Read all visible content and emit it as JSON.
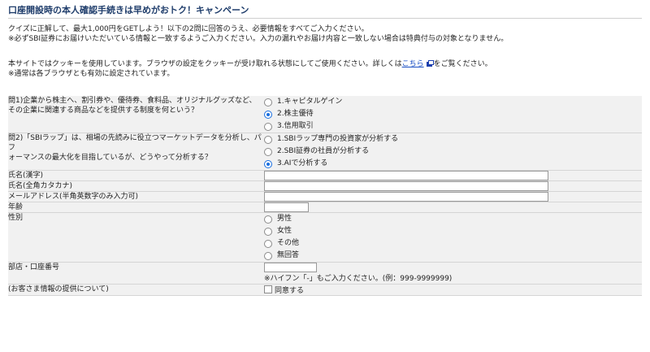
{
  "page": {
    "title": "口座開設時の本人確認手続きは早めがおトク！キャンペーン",
    "intro_line1": "クイズに正解して、最大1,000円をGETしよう！以下の2問に回答のうえ、必要情報をすべてご入力ください。",
    "intro_line2": "※必ずSBI証券にお届けいただいている情報と一致するようご入力ください。入力の漏れやお届け内容と一致しない場合は特典付与の対象となりません。",
    "cookie_line1_pre": "本サイトではクッキーを使用しています。ブラウザの設定をクッキーが受け取れる状態にしてご使用ください。詳しくは",
    "cookie_link": "こちら",
    "cookie_line1_post": "をご覧ください。",
    "cookie_line2": "※通常は各ブラウザとも有効に設定されています。"
  },
  "form": {
    "q1": {
      "label_line1": "問1)企業から株主へ、割引券や、優待券、食料品、オリジナルグッズなど、",
      "label_line2": "その企業に関連する商品などを提供する制度を何という？",
      "options": [
        "1.キャピタルゲイン",
        "2.株主優待",
        "3.信用取引"
      ],
      "selected": 1
    },
    "q2": {
      "label_line1": "問2)「SBIラップ」は、相場の先読みに役立つマーケットデータを分析し、パフ",
      "label_line2": "ォーマンスの最大化を目指しているが、どうやって分析する？",
      "options": [
        "1.SBIラップ専門の投資家が分析する",
        "2.SBI証券の社員が分析する",
        "3.AIで分析する"
      ],
      "selected": 2
    },
    "name_kanji_label": "氏名(漢字)",
    "name_kana_label": "氏名(全角カタカナ)",
    "email_label": "メールアドレス(半角英数字のみ入力可)",
    "age_label": "年齢",
    "gender": {
      "label": "性別",
      "options": [
        "男性",
        "女性",
        "その他",
        "無回答"
      ]
    },
    "branch_label": "部店・口座番号",
    "branch_note": "※ハイフン「-」もご入力ください。(例：999-9999999)",
    "consent_label": "(お客さま情報の提供について)",
    "consent_option": "同意する"
  }
}
